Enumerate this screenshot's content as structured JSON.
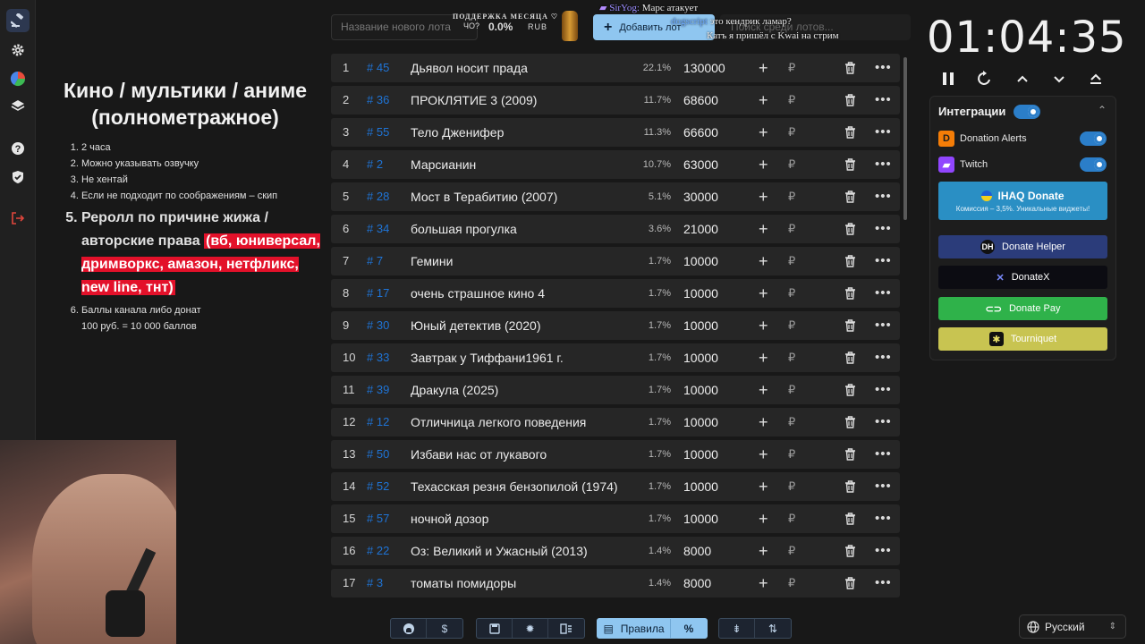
{
  "sidebar": {
    "items": [
      {
        "icon": "gavel-icon",
        "active": true
      },
      {
        "icon": "gear-icon"
      },
      {
        "icon": "pie-chart-icon"
      },
      {
        "icon": "layers-icon"
      },
      {
        "icon": "help-icon"
      },
      {
        "icon": "shield-icon"
      },
      {
        "icon": "logout-icon"
      }
    ]
  },
  "rules": {
    "title": "Кино / мультики / аниме (полнометражное)",
    "items": [
      "2 часа",
      "Можно указывать озвучку",
      "Не хентай",
      "Если не подходит по соображениям – скип"
    ],
    "big_plain": "Реролл по причине жижа / авторские права",
    "big_highlight": "(вб, юниверсал, дримворкс, амазон, нетфликс, new line, тнт)",
    "last_line1": "Баллы канала либо донат",
    "last_line2": "100 руб. = 10 000 баллов"
  },
  "top": {
    "new_lot_placeholder": "Название нового лота",
    "promo_title": "ПОДДЕРЖКА МЕСЯЦА ♡",
    "promo_prefix": "ЧО?",
    "promo_percent": "0.0%",
    "promo_currency": "RUB",
    "add_button": "Добавить лот",
    "search_placeholder": "Поиск среди лотов..."
  },
  "chat": {
    "line1_user": "SirYog:",
    "line1_text": "Марс атакует",
    "line2_user": "dogscript",
    "line2_text": "это кендрик ламар?",
    "line3_text": "Катъ я пришёл с Kwai на стрим"
  },
  "timer": {
    "value": "01:04:35"
  },
  "integrations": {
    "title": "Интеграции",
    "services": [
      {
        "name": "Donation Alerts",
        "enabled": true
      },
      {
        "name": "Twitch",
        "enabled": true
      }
    ],
    "ihaq": {
      "title": "IHAQ Donate",
      "subtitle": "Комиссия – 3,5%. Уникальные виджеты!"
    },
    "partners": [
      {
        "name": "Donate Helper",
        "color": "#2b3c7a"
      },
      {
        "name": "DonateX",
        "color": "#0c0c12"
      },
      {
        "name": "Donate Pay",
        "color": "#2fb24a"
      },
      {
        "name": "Tourniquet",
        "color": "#c8c451"
      }
    ]
  },
  "lots": [
    {
      "n": "1",
      "id": "# 45",
      "name": "Дьявол носит прада",
      "pct": "22.1%",
      "amount": "130000"
    },
    {
      "n": "2",
      "id": "# 36",
      "name": "ПРОКЛЯТИЕ 3 (2009)",
      "pct": "11.7%",
      "amount": "68600"
    },
    {
      "n": "3",
      "id": "# 55",
      "name": "Тело Дженифер",
      "pct": "11.3%",
      "amount": "66600"
    },
    {
      "n": "4",
      "id": "# 2",
      "name": "Марсианин",
      "pct": "10.7%",
      "amount": "63000"
    },
    {
      "n": "5",
      "id": "# 28",
      "name": "Мост в Терабитию (2007)",
      "pct": "5.1%",
      "amount": "30000"
    },
    {
      "n": "6",
      "id": "# 34",
      "name": "большая прогулка",
      "pct": "3.6%",
      "amount": "21000"
    },
    {
      "n": "7",
      "id": "# 7",
      "name": "Гемини",
      "pct": "1.7%",
      "amount": "10000"
    },
    {
      "n": "8",
      "id": "# 17",
      "name": "очень страшное кино 4",
      "pct": "1.7%",
      "amount": "10000"
    },
    {
      "n": "9",
      "id": "# 30",
      "name": "Юный детектив (2020)",
      "pct": "1.7%",
      "amount": "10000"
    },
    {
      "n": "10",
      "id": "# 33",
      "name": "Завтрак у Тиффани1961 г.",
      "pct": "1.7%",
      "amount": "10000"
    },
    {
      "n": "11",
      "id": "# 39",
      "name": "Дракула (2025)",
      "pct": "1.7%",
      "amount": "10000"
    },
    {
      "n": "12",
      "id": "# 12",
      "name": "Отличница легкого поведения",
      "pct": "1.7%",
      "amount": "10000"
    },
    {
      "n": "13",
      "id": "# 50",
      "name": "Избави нас от лукавого",
      "pct": "1.7%",
      "amount": "10000"
    },
    {
      "n": "14",
      "id": "# 52",
      "name": "Техасская резня бензопилой (1974)",
      "pct": "1.7%",
      "amount": "10000"
    },
    {
      "n": "15",
      "id": "# 57",
      "name": "ночной дозор",
      "pct": "1.7%",
      "amount": "10000"
    },
    {
      "n": "16",
      "id": "# 22",
      "name": "Оз: Великий и Ужасный (2013)",
      "pct": "1.4%",
      "amount": "8000"
    },
    {
      "n": "17",
      "id": "# 3",
      "name": "томаты помидоры",
      "pct": "1.4%",
      "amount": "8000"
    }
  ],
  "bottom": {
    "rules_button": "Правила",
    "percent_button": "%",
    "language": "Русский",
    "currency_symbol": "₽"
  }
}
